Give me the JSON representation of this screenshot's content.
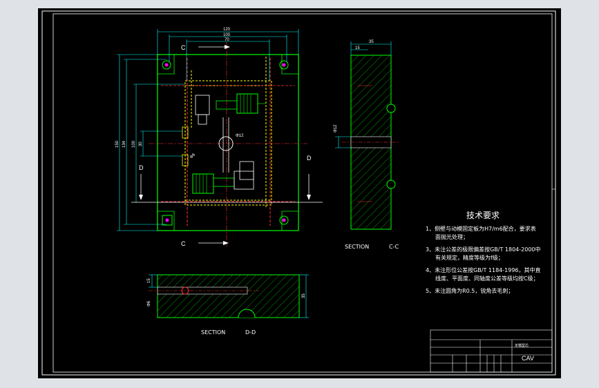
{
  "viewport": {
    "background": "#000000",
    "page_background": "#dfe3e8"
  },
  "colors": {
    "plate": "#00ff00",
    "cavity": "#ffff00",
    "hidden": "#ff3030",
    "dimension": "#00ffff",
    "text": "#ffffff",
    "hole": "#ff00ff"
  },
  "main_view": {
    "dims": {
      "width_total": "120",
      "width_inner": "100",
      "width_center": "70",
      "height_total": "150",
      "height_a": "134",
      "height_b": "100",
      "height_c": "30",
      "hole_dia": "Φ12",
      "hole_small": "Φ6"
    },
    "cut_labels": {
      "c_top": "C",
      "c_bottom": "C",
      "d_left": "D",
      "d_right": "D"
    }
  },
  "section_cc": {
    "label": "SECTION",
    "id": "C-C",
    "dims": {
      "width": "35",
      "offset": "15",
      "hole": "Φ12"
    }
  },
  "section_dd": {
    "label": "SECTION",
    "id": "D-D",
    "dims": {
      "height": "35",
      "offset": "15",
      "hole": "Φ6"
    }
  },
  "tech_requirements": {
    "title": "技术要求",
    "items": [
      "1、侧壁与动模固定板为H7/m6配合，要求表",
      "面抛光处理；",
      "3、未注公差的极限偏差按GB/T 1804-2000中",
      "有关规定，精度等级为f级；",
      "4、未注形位公差按GB/T 1184-1996，其中直",
      "线度、平面度、同轴度公差等级均按C级；",
      "5、未注圆角为R0.5，锐角去毛刺；"
    ]
  },
  "title_block": {
    "code": "CAV",
    "part": "定模型芯"
  }
}
